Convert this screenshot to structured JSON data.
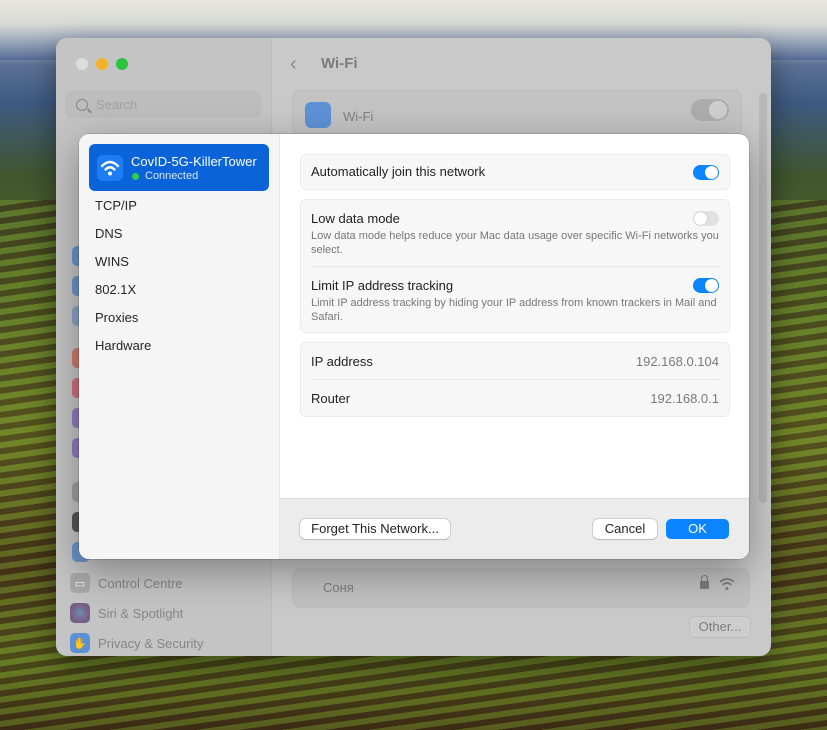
{
  "settings_window": {
    "title": "Wi-Fi",
    "search_placeholder": "Search",
    "wifi_toggle_label": "Wi-Fi",
    "wifi_enabled": true,
    "sidebar_items": [
      {
        "label": "Control Centre",
        "icon": "control-centre-icon"
      },
      {
        "label": "Siri & Spotlight",
        "icon": "siri-icon"
      },
      {
        "label": "Privacy & Security",
        "icon": "hand-icon"
      }
    ],
    "known_networks": [
      {
        "name": "Соня",
        "secured": true
      }
    ],
    "other_button": "Other..."
  },
  "sheet": {
    "network": {
      "name": "CovID-5G-KillerTower",
      "status": "Connected",
      "status_color": "#33cc48"
    },
    "tabs": [
      "TCP/IP",
      "DNS",
      "WINS",
      "802.1X",
      "Proxies",
      "Hardware"
    ],
    "auto_join": {
      "label": "Automatically join this network",
      "on": true
    },
    "low_data": {
      "label": "Low data mode",
      "description": "Low data mode helps reduce your Mac data usage over specific Wi-Fi networks you select.",
      "on": false
    },
    "limit_ip": {
      "label": "Limit IP address tracking",
      "description": "Limit IP address tracking by hiding your IP address from known trackers in Mail and Safari.",
      "on": true
    },
    "info": [
      {
        "key": "IP address",
        "value": "192.168.0.104"
      },
      {
        "key": "Router",
        "value": "192.168.0.1"
      }
    ],
    "buttons": {
      "forget": "Forget This Network...",
      "cancel": "Cancel",
      "ok": "OK"
    },
    "accent_color": "#0a84ff"
  }
}
